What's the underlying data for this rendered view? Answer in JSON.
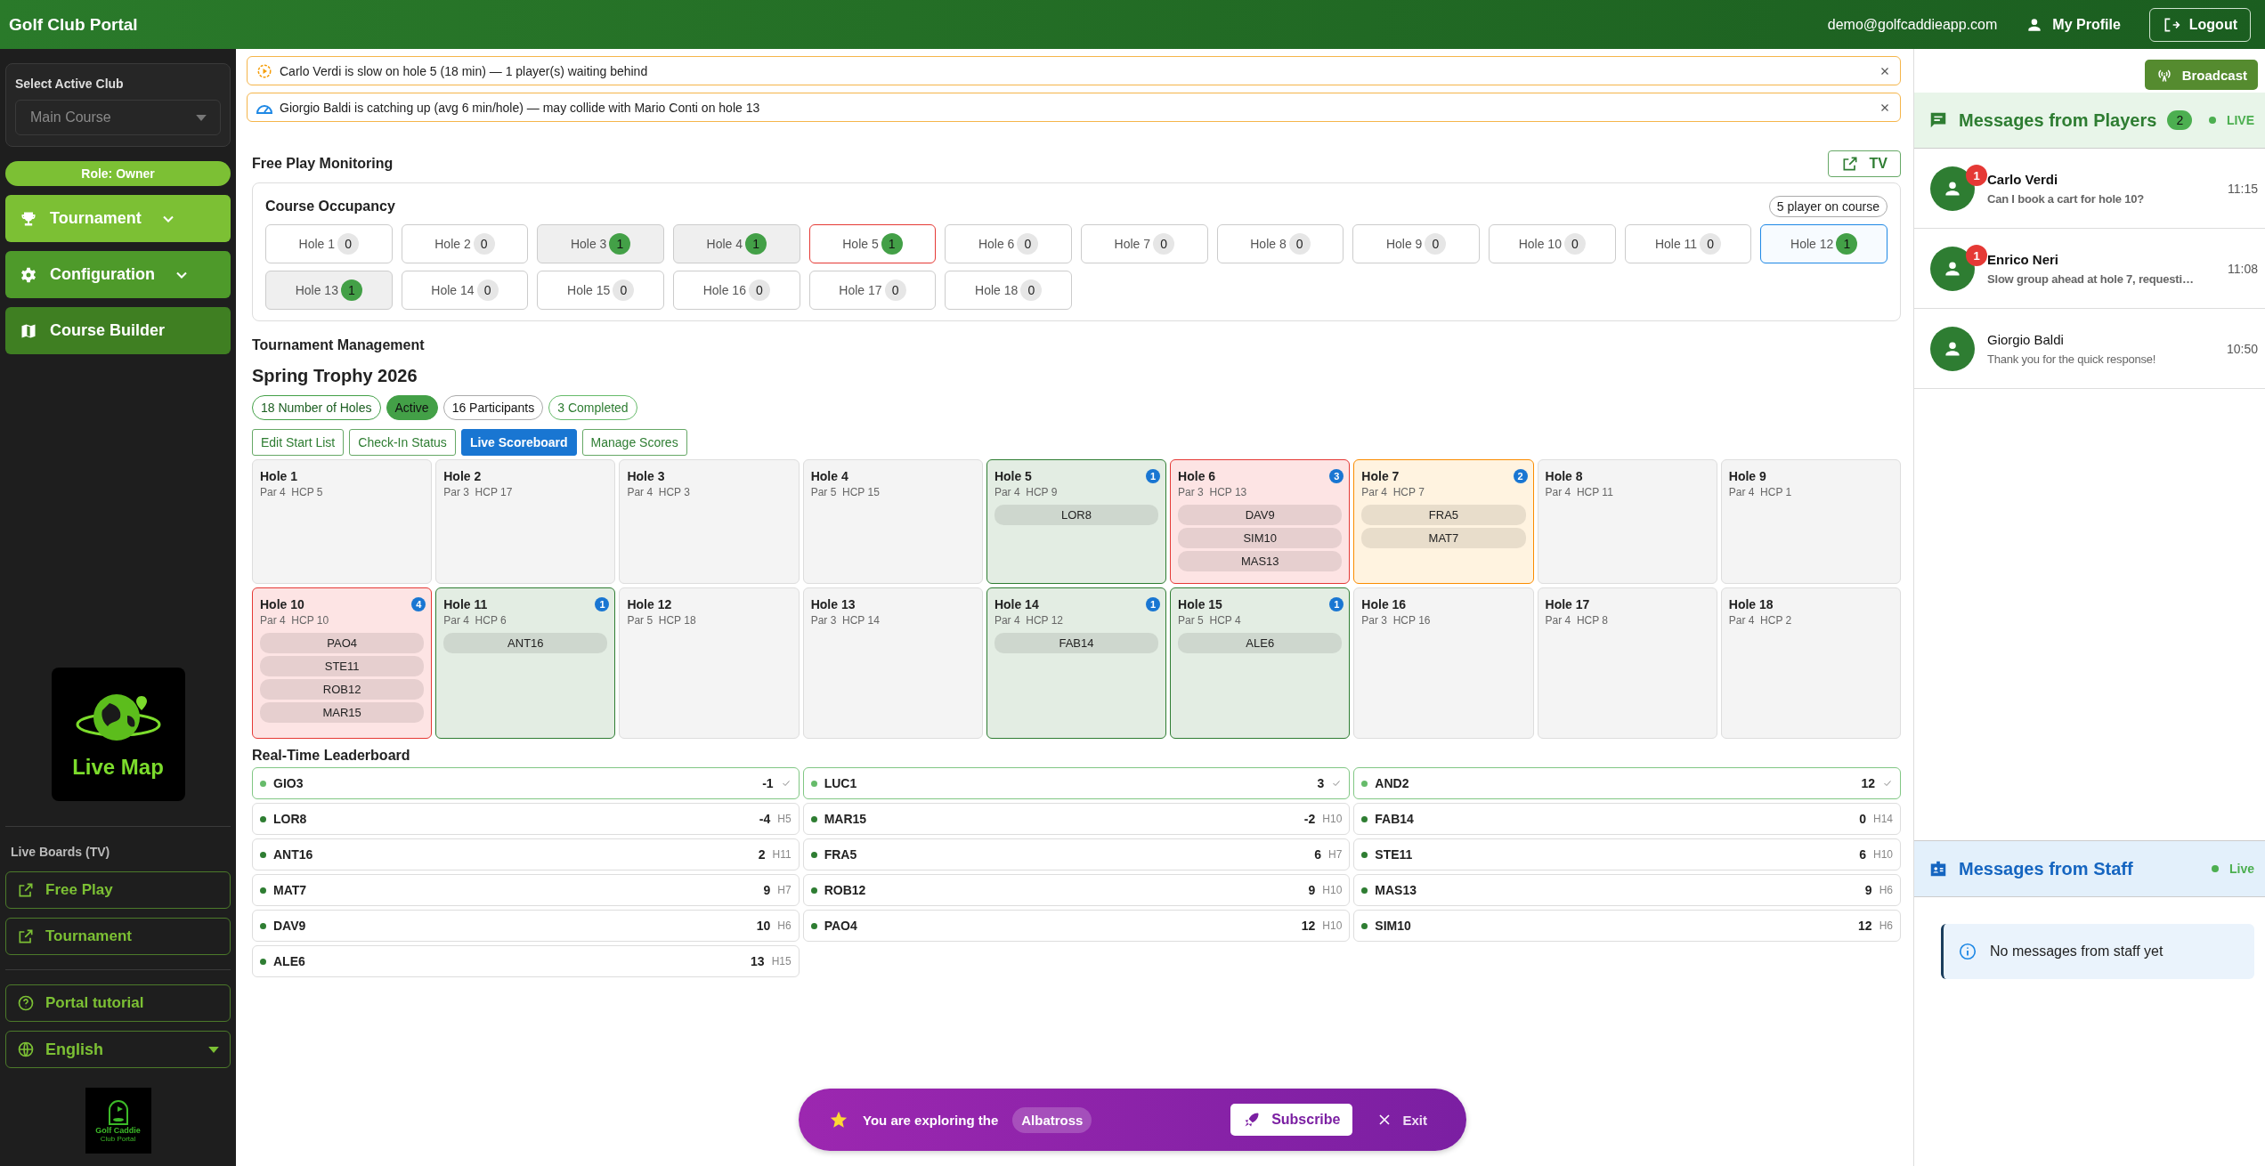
{
  "app_title": "Golf Club Portal",
  "header": {
    "email": "demo@golfcaddieapp.com",
    "profile": "My Profile",
    "logout": "Logout"
  },
  "sidebar": {
    "club_label": "Select Active Club",
    "club_placeholder": "Main Course",
    "role": "Role: Owner",
    "nav": [
      {
        "label": "Tournament",
        "expandable": true,
        "color": "#7cc034"
      },
      {
        "label": "Configuration",
        "expandable": true,
        "color": "#4e9a2a"
      },
      {
        "label": "Course Builder",
        "expandable": false,
        "color": "#3f7f22"
      }
    ],
    "live_map": "Live Map",
    "boards_title": "Live Boards (TV)",
    "boards": [
      {
        "label": "Free Play"
      },
      {
        "label": "Tournament"
      }
    ],
    "tutorial": "Portal tutorial",
    "language": "English",
    "logo_line1": "Golf Caddie",
    "logo_line2": "Club Portal"
  },
  "alerts": [
    {
      "kind": "slow",
      "text": "Carlo Verdi is slow on hole 5 (18 min) — 1 player(s) waiting behind"
    },
    {
      "kind": "catching_up",
      "text": "Giorgio Baldi is catching up (avg 6 min/hole) — may collide with Mario Conti on hole 13"
    }
  ],
  "free_play": {
    "title": "Free Play Monitoring",
    "tv_button": "TV",
    "occupancy_title": "Course Occupancy",
    "on_course": "5 player on course",
    "holes": [
      {
        "label": "Hole 1",
        "count": "0",
        "kind": "empty"
      },
      {
        "label": "Hole 2",
        "count": "0",
        "kind": "empty"
      },
      {
        "label": "Hole 3",
        "count": "1",
        "kind": "occupied"
      },
      {
        "label": "Hole 4",
        "count": "1",
        "kind": "occupied"
      },
      {
        "label": "Hole 5",
        "count": "1",
        "kind": "slow"
      },
      {
        "label": "Hole 6",
        "count": "0",
        "kind": "empty"
      },
      {
        "label": "Hole 7",
        "count": "0",
        "kind": "empty"
      },
      {
        "label": "Hole 8",
        "count": "0",
        "kind": "empty"
      },
      {
        "label": "Hole 9",
        "count": "0",
        "kind": "empty"
      },
      {
        "label": "Hole 10",
        "count": "0",
        "kind": "empty"
      },
      {
        "label": "Hole 11",
        "count": "0",
        "kind": "empty"
      },
      {
        "label": "Hole 12",
        "count": "1",
        "kind": "fast"
      },
      {
        "label": "Hole 13",
        "count": "1",
        "kind": "occupied"
      },
      {
        "label": "Hole 14",
        "count": "0",
        "kind": "empty"
      },
      {
        "label": "Hole 15",
        "count": "0",
        "kind": "empty"
      },
      {
        "label": "Hole 16",
        "count": "0",
        "kind": "empty"
      },
      {
        "label": "Hole 17",
        "count": "0",
        "kind": "empty"
      },
      {
        "label": "Hole 18",
        "count": "0",
        "kind": "empty"
      }
    ]
  },
  "tournament": {
    "section_title": "Tournament Management",
    "name": "Spring Trophy 2026",
    "chips": [
      {
        "label": "18 Number of Holes",
        "kind": "outline"
      },
      {
        "label": "Active",
        "kind": "filled"
      },
      {
        "label": "16 Participants",
        "kind": "neutral"
      },
      {
        "label": "3 Completed",
        "kind": "success"
      }
    ],
    "actions": [
      {
        "label": "Edit Start List",
        "selected": false
      },
      {
        "label": "Check-In Status",
        "selected": false
      },
      {
        "label": "Live Scoreboard",
        "selected": true
      },
      {
        "label": "Manage Scores",
        "selected": false
      }
    ],
    "holes": [
      {
        "name": "Hole 1",
        "info": "Par 4  HCP 5",
        "kind": "empty"
      },
      {
        "name": "Hole 2",
        "info": "Par 3  HCP 17",
        "kind": "empty"
      },
      {
        "name": "Hole 3",
        "info": "Par 4  HCP 3",
        "kind": "empty"
      },
      {
        "name": "Hole 4",
        "info": "Par 5  HCP 15",
        "kind": "empty"
      },
      {
        "name": "Hole 5",
        "info": "Par 4  HCP 9",
        "kind": "playing",
        "count": "1",
        "players": [
          "LOR8"
        ]
      },
      {
        "name": "Hole 6",
        "info": "Par 3  HCP 13",
        "kind": "slow",
        "count": "3",
        "players": [
          "DAV9",
          "SIM10",
          "MAS13"
        ]
      },
      {
        "name": "Hole 7",
        "info": "Par 4  HCP 7",
        "kind": "warning",
        "count": "2",
        "players": [
          "FRA5",
          "MAT7"
        ]
      },
      {
        "name": "Hole 8",
        "info": "Par 4  HCP 11",
        "kind": "empty"
      },
      {
        "name": "Hole 9",
        "info": "Par 4  HCP 1",
        "kind": "empty"
      },
      {
        "name": "Hole 10",
        "info": "Par 4  HCP 10",
        "kind": "slow",
        "count": "4",
        "players": [
          "PAO4",
          "STE11",
          "ROB12",
          "MAR15"
        ]
      },
      {
        "name": "Hole 11",
        "info": "Par 4  HCP 6",
        "kind": "playing",
        "count": "1",
        "players": [
          "ANT16"
        ]
      },
      {
        "name": "Hole 12",
        "info": "Par 5  HCP 18",
        "kind": "empty"
      },
      {
        "name": "Hole 13",
        "info": "Par 3  HCP 14",
        "kind": "empty"
      },
      {
        "name": "Hole 14",
        "info": "Par 4  HCP 12",
        "kind": "playing",
        "count": "1",
        "players": [
          "FAB14"
        ]
      },
      {
        "name": "Hole 15",
        "info": "Par 5  HCP 4",
        "kind": "playing",
        "count": "1",
        "players": [
          "ALE6"
        ]
      },
      {
        "name": "Hole 16",
        "info": "Par 3  HCP 16",
        "kind": "empty"
      },
      {
        "name": "Hole 17",
        "info": "Par 4  HCP 8",
        "kind": "empty"
      },
      {
        "name": "Hole 18",
        "info": "Par 4  HCP 2",
        "kind": "empty"
      }
    ],
    "leaderboard_title": "Real-Time Leaderboard",
    "leaderboard": [
      {
        "name": "GIO3",
        "score": "-1",
        "finished": true
      },
      {
        "name": "LUC1",
        "score": "3",
        "finished": true
      },
      {
        "name": "AND2",
        "score": "12",
        "finished": true
      },
      {
        "name": "LOR8",
        "score": "-4",
        "hole": "H5",
        "finished": false
      },
      {
        "name": "MAR15",
        "score": "-2",
        "hole": "H10",
        "finished": false
      },
      {
        "name": "FAB14",
        "score": "0",
        "hole": "H14",
        "finished": false
      },
      {
        "name": "ANT16",
        "score": "2",
        "hole": "H11",
        "finished": false
      },
      {
        "name": "FRA5",
        "score": "6",
        "hole": "H7",
        "finished": false
      },
      {
        "name": "STE11",
        "score": "6",
        "hole": "H10",
        "finished": false
      },
      {
        "name": "MAT7",
        "score": "9",
        "hole": "H7",
        "finished": false
      },
      {
        "name": "ROB12",
        "score": "9",
        "hole": "H10",
        "finished": false
      },
      {
        "name": "MAS13",
        "score": "9",
        "hole": "H6",
        "finished": false
      },
      {
        "name": "DAV9",
        "score": "10",
        "hole": "H6",
        "finished": false
      },
      {
        "name": "PAO4",
        "score": "12",
        "hole": "H10",
        "finished": false
      },
      {
        "name": "SIM10",
        "score": "12",
        "hole": "H6",
        "finished": false
      },
      {
        "name": "ALE6",
        "score": "13",
        "hole": "H15",
        "finished": false
      }
    ]
  },
  "messages": {
    "broadcast": "Broadcast",
    "players_title": "Messages from Players",
    "players_count": "2",
    "players_live": "LIVE",
    "items": [
      {
        "name": "Carlo Verdi",
        "text": "Can I book a cart for hole 10?",
        "time": "11:15",
        "unread": true,
        "badge": "1"
      },
      {
        "name": "Enrico Neri",
        "text": "Slow group ahead at hole 7, requesti…",
        "time": "11:08",
        "unread": true,
        "badge": "1"
      },
      {
        "name": "Giorgio Baldi",
        "text": "Thank you for the quick response!",
        "time": "10:50",
        "unread": false
      }
    ],
    "staff_title": "Messages from Staff",
    "staff_live": "Live",
    "staff_empty": "No messages from staff yet"
  },
  "banner": {
    "text": "You are exploring the",
    "plan": "Albatross",
    "subscribe": "Subscribe",
    "exit": "Exit"
  }
}
